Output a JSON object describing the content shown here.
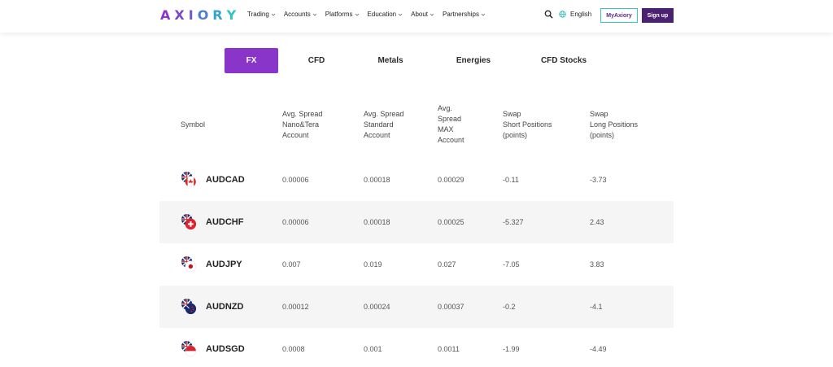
{
  "header": {
    "logo": [
      "A",
      "X",
      "I",
      "O",
      "R",
      "Y"
    ],
    "logo_colors": [
      "#8a35c9",
      "#7b45cc",
      "#6a58cf",
      "#4f7fd0",
      "#35a3cf",
      "#2cc4c4"
    ],
    "nav": [
      "Trading",
      "Accounts",
      "Platforms",
      "Education",
      "About",
      "Partnerships"
    ],
    "language": "English",
    "myaxiory": "MyAxiory",
    "signup": "Sign up"
  },
  "tabs": [
    "FX",
    "CFD",
    "Metals",
    "Energies",
    "CFD Stocks"
  ],
  "table": {
    "headers": {
      "symbol": "Symbol",
      "nano": [
        "Avg. Spread",
        "Nano&Tera",
        "Account"
      ],
      "standard": [
        "Avg. Spread",
        "Standard",
        "Account"
      ],
      "max": [
        "Avg.",
        "Spread",
        "MAX",
        "Account"
      ],
      "short": [
        "Swap",
        "Short Positions",
        "(points)"
      ],
      "long": [
        "Swap",
        "Long Positions",
        "(points)"
      ]
    },
    "rows": [
      {
        "symbol": "AUDCAD",
        "nano": "0.00006",
        "standard": "0.00018",
        "max": "0.00029",
        "short": "-0.11",
        "long": "-3.73"
      },
      {
        "symbol": "AUDCHF",
        "nano": "0.00006",
        "standard": "0.00018",
        "max": "0.00025",
        "short": "-5.327",
        "long": "2.43"
      },
      {
        "symbol": "AUDJPY",
        "nano": "0.007",
        "standard": "0.019",
        "max": "0.027",
        "short": "-7.05",
        "long": "3.83"
      },
      {
        "symbol": "AUDNZD",
        "nano": "0.00012",
        "standard": "0.00024",
        "max": "0.00037",
        "short": "-0.2",
        "long": "-4.1"
      },
      {
        "symbol": "AUDSGD",
        "nano": "0.0008",
        "standard": "0.001",
        "max": "0.0011",
        "short": "-1.99",
        "long": "-4.49"
      }
    ]
  },
  "colors": {
    "accent": "#8a35c9",
    "brand_dark": "#4b2171",
    "teal": "#3cc4c4"
  }
}
